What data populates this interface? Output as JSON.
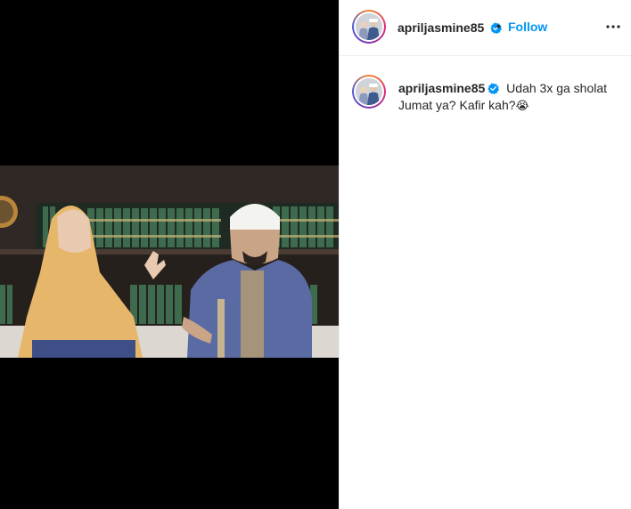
{
  "post": {
    "username": "apriljasmine85",
    "separator": "•",
    "follow_label": "Follow",
    "caption_text": "Udah 3x ga sholat Jumat ya? Kafir kah?",
    "caption_emoji": "😭"
  },
  "colors": {
    "accent": "#0095f6",
    "verified": "#0095f6",
    "media_background": "#000000"
  },
  "icons": {
    "verified": "verified-badge-icon",
    "more": "more-options-icon"
  }
}
